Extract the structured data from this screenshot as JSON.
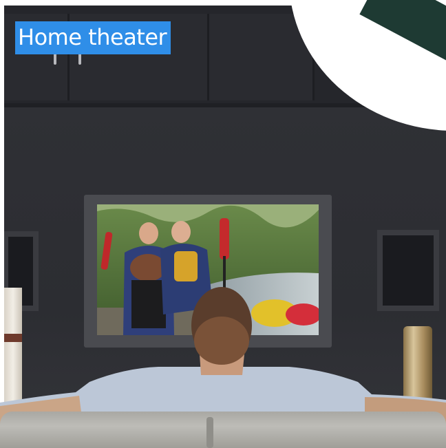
{
  "label": {
    "text": "Home theater",
    "background": "#2f8ee8",
    "color": "#ffffff"
  },
  "scene": {
    "wall_color": "#2c2d32",
    "tv_bezel_color": "#4a4b50"
  }
}
